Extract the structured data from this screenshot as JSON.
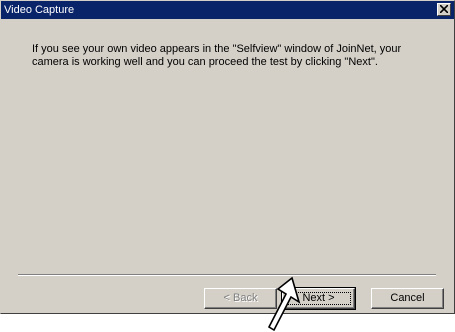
{
  "window": {
    "title": "Video Capture"
  },
  "message": "If you see your own video appears in the \"Selfview\" window of JoinNet, your camera is working well and you can proceed the test by clicking \"Next\".",
  "buttons": {
    "back": "< Back",
    "next": "Next >",
    "cancel": "Cancel"
  },
  "colors": {
    "titlebar": "#0a246a",
    "dialog_face": "#d4d0c8"
  },
  "icons": {
    "close": "close-icon",
    "cursor": "arrow-pointer-icon"
  }
}
